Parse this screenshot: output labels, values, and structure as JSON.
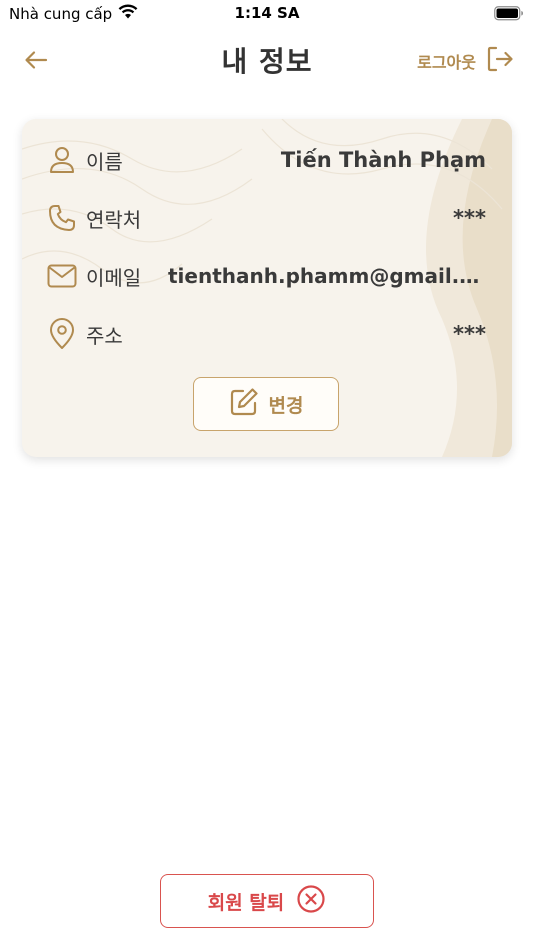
{
  "status_bar": {
    "carrier": "Nhà cung cấp",
    "time": "1:14 SA"
  },
  "header": {
    "title": "내 정보",
    "logout_label": "로그아웃"
  },
  "profile": {
    "rows": [
      {
        "label": "이름",
        "value": "Tiến Thành Phạm",
        "icon": "person-icon"
      },
      {
        "label": "연락처",
        "value": "***",
        "icon": "phone-icon"
      },
      {
        "label": "이메일",
        "value": "tienthanh.phamm@gmail.c…",
        "icon": "mail-icon"
      },
      {
        "label": "주소",
        "value": "***",
        "icon": "location-pin-icon"
      }
    ],
    "edit_label": "변경"
  },
  "footer": {
    "withdraw_label": "회원 탈퇴"
  },
  "colors": {
    "accent": "#b08a4f",
    "danger": "#d9484a",
    "card_bg": "#f7f3ec"
  }
}
